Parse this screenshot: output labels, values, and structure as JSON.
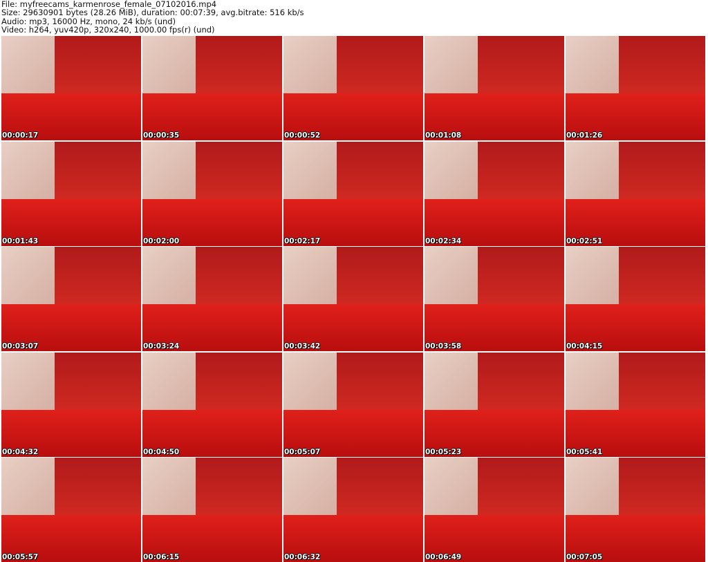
{
  "header": {
    "line1": "File: myfreecams_karmenrose_female_07102016.mp4",
    "line2": "Size: 29630901 bytes (28.26 MiB), duration: 00:07:39, avg.bitrate: 516 kb/s",
    "line3": "Audio: mp3, 16000 Hz, mono, 24 kb/s (und)",
    "line4": "Video: h264, yuv420p, 320x240, 1000.00 fps(r) (und)"
  },
  "timestamps": [
    "00:00:17",
    "00:00:35",
    "00:00:52",
    "00:01:08",
    "00:01:26",
    "00:01:43",
    "00:02:00",
    "00:02:17",
    "00:02:34",
    "00:02:51",
    "00:03:07",
    "00:03:24",
    "00:03:42",
    "00:03:58",
    "00:04:15",
    "00:04:32",
    "00:04:50",
    "00:05:07",
    "00:05:23",
    "00:05:41",
    "00:05:57",
    "00:06:15",
    "00:06:32",
    "00:06:49",
    "00:07:05"
  ]
}
